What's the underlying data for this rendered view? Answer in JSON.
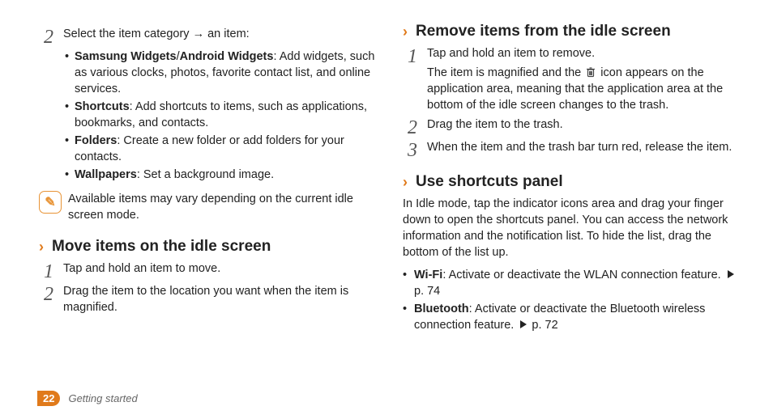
{
  "left": {
    "step2": {
      "num": "2",
      "intro": "Select the item category → an item:",
      "bullets": {
        "a": {
          "bold": "Samsung Widgets",
          "sep": "/",
          "bold2": "Android Widgets",
          "rest": ": Add widgets, such as various clocks, photos, favorite contact list, and online services."
        },
        "b": {
          "bold": "Shortcuts",
          "rest": ": Add shortcuts to items, such as applications, bookmarks, and contacts."
        },
        "c": {
          "bold": "Folders",
          "rest": ": Create a new folder or add folders for your contacts."
        },
        "d": {
          "bold": "Wallpapers",
          "rest": ": Set a background image."
        }
      }
    },
    "note": "Available items may vary depending on the current idle screen mode.",
    "move": {
      "title": "Move items on the idle screen",
      "steps": {
        "1": {
          "num": "1",
          "text": "Tap and hold an item to move."
        },
        "2": {
          "num": "2",
          "text": "Drag the item to the location you want when the item is magnified."
        }
      }
    }
  },
  "right": {
    "remove": {
      "title": "Remove items from the idle screen",
      "step1": {
        "num": "1",
        "line1": "Tap and hold an item to remove.",
        "line2a": "The item is magnified and the ",
        "line2b": " icon appears on the application area, meaning that the application area at the bottom of the idle screen changes to the trash."
      },
      "step2": {
        "num": "2",
        "text": "Drag the item to the trash."
      },
      "step3": {
        "num": "3",
        "text": "When the item and the trash bar turn red, release the item."
      }
    },
    "shortcuts": {
      "title": "Use shortcuts panel",
      "para": "In Idle mode, tap the indicator icons area and drag your finger down to open the shortcuts panel. You can access the network information and the notification list. To hide the list, drag the bottom of the list up.",
      "bullets": {
        "wifi": {
          "bold": "Wi-Fi",
          "rest": ": Activate or deactivate the WLAN connection feature. ",
          "page": " p. 74"
        },
        "bt": {
          "bold": "Bluetooth",
          "rest": ": Activate or deactivate the Bluetooth wireless connection feature. ",
          "page": " p. 72"
        }
      }
    }
  },
  "footer": {
    "page": "22",
    "section": "Getting started"
  },
  "glyphs": {
    "dot": "•",
    "note_icon": "✎"
  }
}
